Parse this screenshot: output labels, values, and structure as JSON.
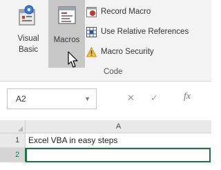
{
  "ribbon": {
    "visual_basic": {
      "line1": "Visual",
      "line2": "Basic"
    },
    "macros": {
      "label": "Macros"
    },
    "record_macro": {
      "label": "Record Macro"
    },
    "relative_refs": {
      "label": "Use Relative References"
    },
    "macro_security": {
      "label": "Macro Security"
    },
    "group_label": "Code",
    "colors": {
      "record_red": "#c0392b",
      "warning_yellow": "#f2c12e",
      "table_blue": "#2b5797",
      "excel_green": "#217346"
    }
  },
  "formula_bar": {
    "name_box": "A2",
    "fx_label": "fx"
  },
  "grid": {
    "column_header": "A",
    "rows": [
      {
        "num": "1",
        "value": "Excel VBA in easy steps"
      },
      {
        "num": "2",
        "value": ""
      }
    ]
  }
}
